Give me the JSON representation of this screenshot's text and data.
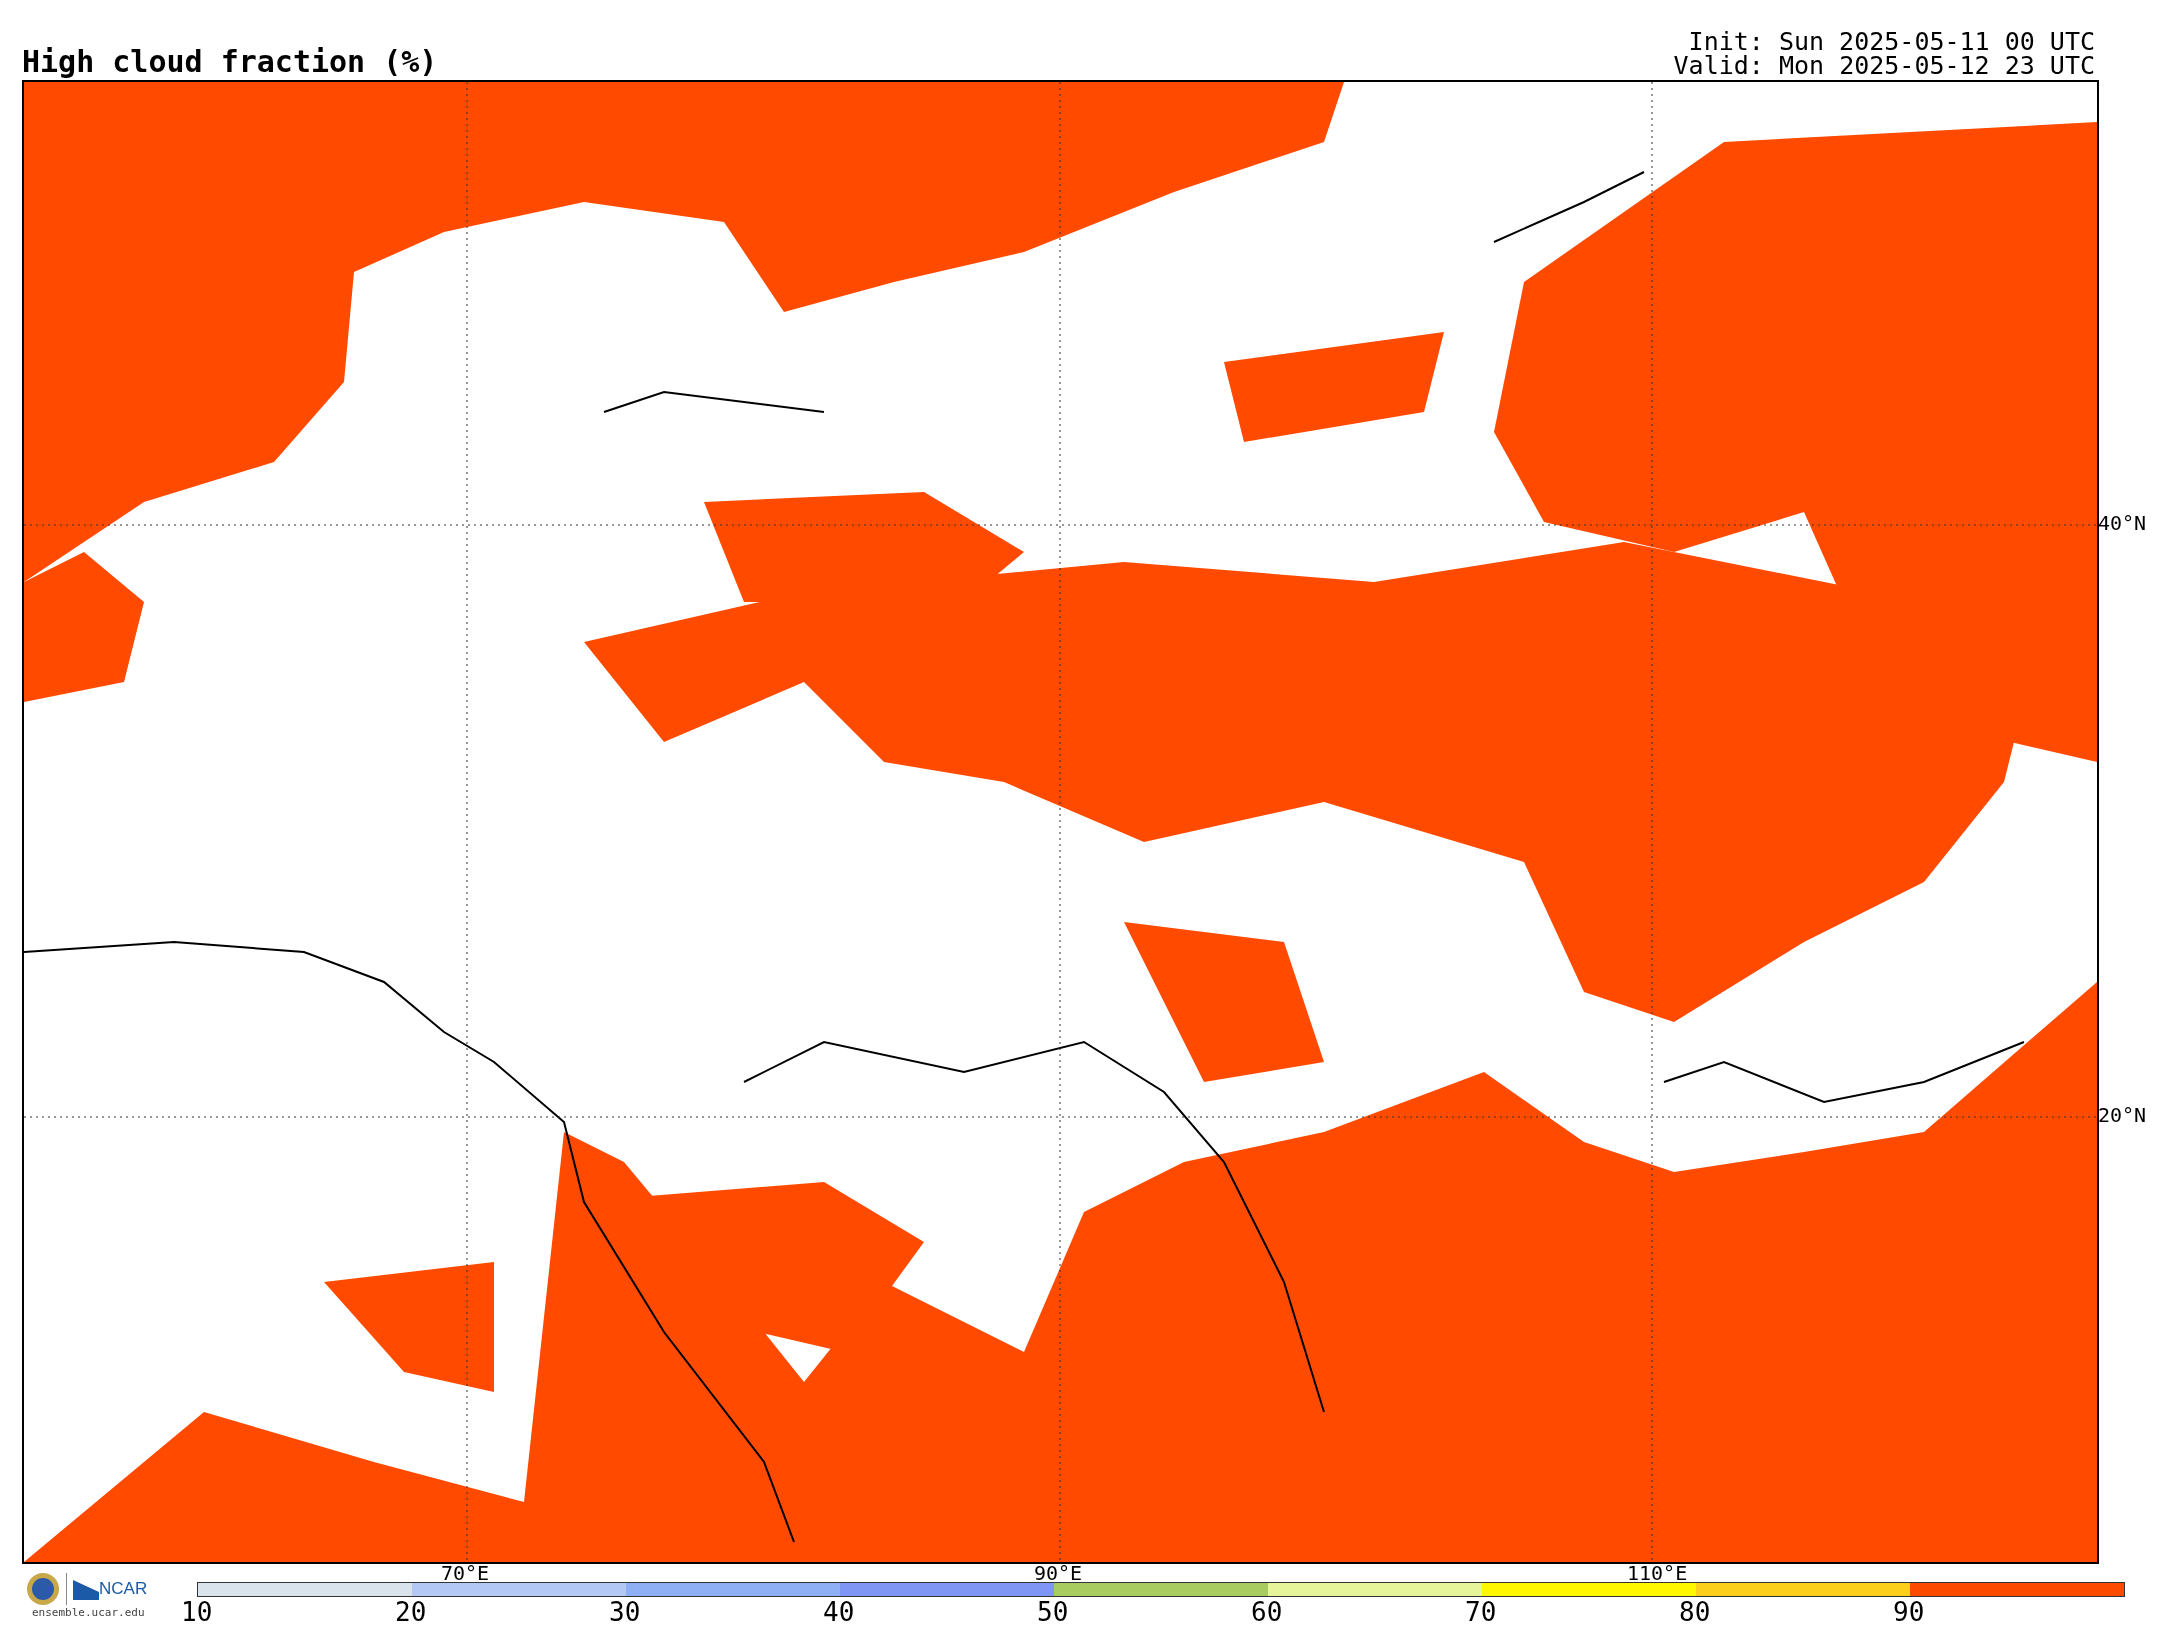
{
  "title": "High cloud fraction (%)",
  "init": "Init: Sun 2025-05-11 00 UTC",
  "valid": "Valid: Mon 2025-05-12 23 UTC",
  "map": {
    "lat_labels": [
      "40°N",
      "20°N"
    ],
    "lon_labels": [
      "70°E",
      "90°E",
      "110°E"
    ]
  },
  "logo": {
    "name": "NCAR",
    "url": "ensemble.ucar.edu"
  },
  "colorbar": {
    "segments": [
      {
        "color": "#d9e3ec"
      },
      {
        "color": "#b3c8f5"
      },
      {
        "color": "#8fb0f5"
      },
      {
        "color": "#7f96f5"
      },
      {
        "color": "#a8cc60"
      },
      {
        "color": "#e6f59a"
      },
      {
        "color": "#fff700"
      },
      {
        "color": "#fccf1c"
      },
      {
        "color": "#fc4b00"
      }
    ],
    "ticks": [
      "10",
      "20",
      "30",
      "40",
      "50",
      "60",
      "70",
      "80",
      "90"
    ]
  }
}
